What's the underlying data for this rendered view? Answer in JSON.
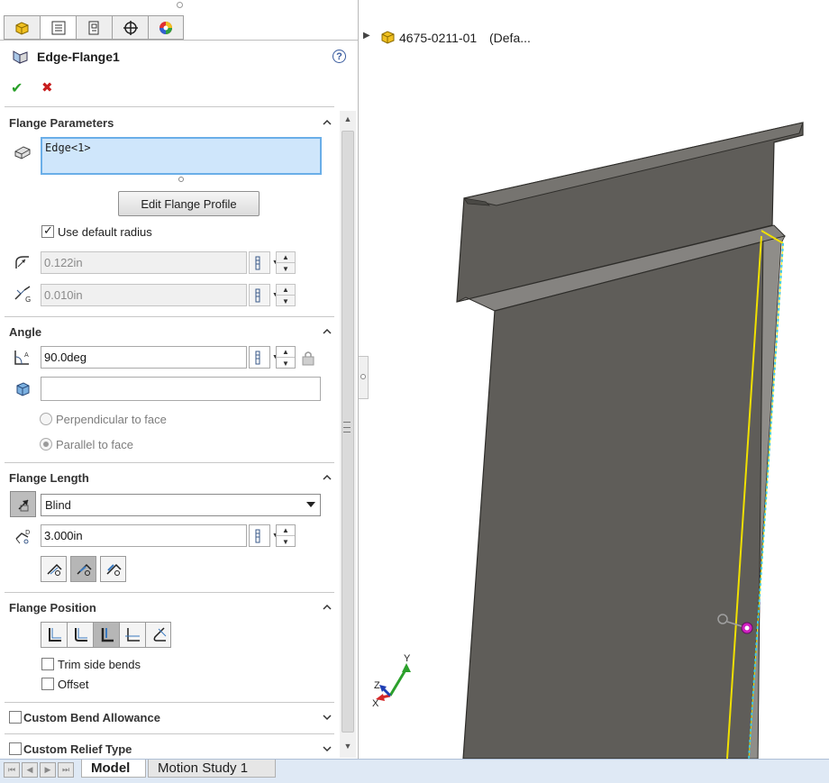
{
  "property_manager": {
    "title": "Edge-Flange1",
    "help_symbol": "?",
    "ok_symbol": "✔",
    "cancel_symbol": "✖",
    "tabs": [
      "feature-manager",
      "property-manager",
      "configuration-manager",
      "dimxpert-manager",
      "display-manager"
    ],
    "flange_parameters": {
      "title": "Flange Parameters",
      "selection": "Edge<1>",
      "edit_button": "Edit Flange Profile",
      "use_default_radius_label": "Use default radius",
      "use_default_radius": true,
      "radius": "0.122in",
      "gap": "0.010in"
    },
    "angle": {
      "title": "Angle",
      "value": "90.0deg",
      "face_selection": "",
      "perpendicular_label": "Perpendicular to face",
      "parallel_label": "Parallel to face",
      "selected_option": "parallel"
    },
    "flange_length": {
      "title": "Flange Length",
      "end_condition": "Blind",
      "length": "3.000in"
    },
    "flange_position": {
      "title": "Flange Position",
      "trim_side_bends_label": "Trim side bends",
      "trim_side_bends": false,
      "offset_label": "Offset",
      "offset": false
    },
    "custom_bend_allowance_label": "Custom Bend Allowance",
    "custom_relief_type_label": "Custom Relief Type"
  },
  "bottom_tabs": {
    "model": "Model",
    "motion_study": "Motion Study 1"
  },
  "viewport": {
    "part_name": "4675-0211-01",
    "config": "(Defa...",
    "model_color": "#5f5d59",
    "edge_highlight": "#f0e000",
    "triad": {
      "x": "X",
      "y": "Y",
      "z": "Z"
    }
  },
  "colors": {
    "selection_bg": "#cfe6fb",
    "selection_border": "#6aaee8",
    "ok": "#2aa02a",
    "cancel": "#c81e1e"
  }
}
